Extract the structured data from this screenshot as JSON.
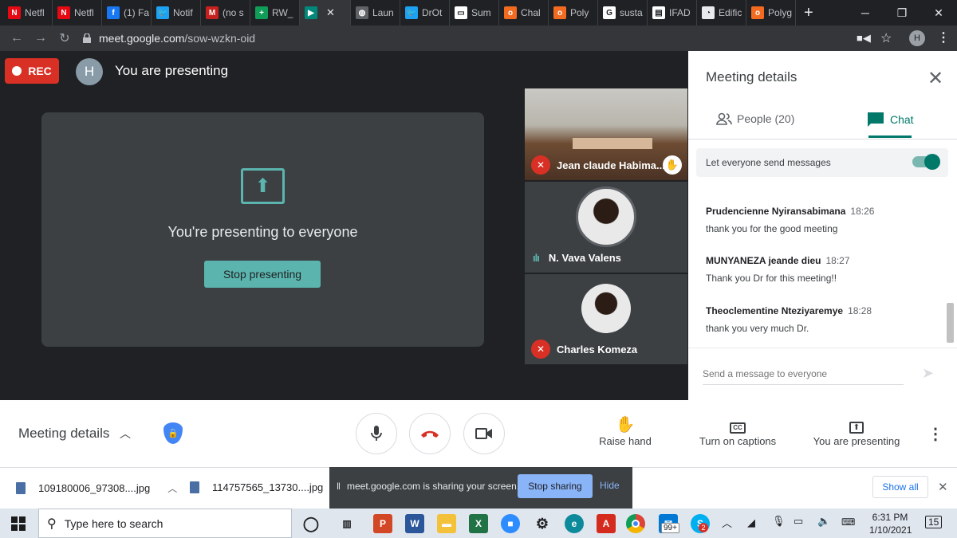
{
  "browser": {
    "tabs": [
      {
        "label": "Netfl",
        "icon": "netflix-icon",
        "color": "#e50914",
        "glyph": "N"
      },
      {
        "label": "Netfl",
        "icon": "netflix-icon",
        "color": "#e50914",
        "glyph": "N"
      },
      {
        "label": "(1) Fa",
        "icon": "facebook-icon",
        "color": "#1877f2",
        "glyph": "f"
      },
      {
        "label": "Notif",
        "icon": "twitter-icon",
        "color": "#1da1f2",
        "glyph": "🐦"
      },
      {
        "label": "(no s",
        "icon": "gmail-icon",
        "color": "#c5221f",
        "glyph": "M"
      },
      {
        "label": "RW_",
        "icon": "sheets-icon",
        "color": "#0f9d58",
        "glyph": "+"
      },
      {
        "label": "",
        "icon": "meet-icon",
        "color": "#00897b",
        "glyph": "▶",
        "active": true
      },
      {
        "label": "Laun",
        "icon": "globe-icon",
        "color": "#5f6368",
        "glyph": "◍"
      },
      {
        "label": "DrOt",
        "icon": "twitter-icon",
        "color": "#1da1f2",
        "glyph": "🐦"
      },
      {
        "label": "Sum",
        "icon": "page-icon",
        "color": "#ffffff",
        "glyph": "▭"
      },
      {
        "label": "Chal",
        "icon": "polyglot-icon",
        "color": "#f26b21",
        "glyph": "o"
      },
      {
        "label": "Poly",
        "icon": "polyglot-icon",
        "color": "#f26b21",
        "glyph": "o"
      },
      {
        "label": "susta",
        "icon": "google-icon",
        "color": "#ffffff",
        "glyph": "G"
      },
      {
        "label": "IFAD",
        "icon": "ifad-icon",
        "color": "#ffffff",
        "glyph": "▤"
      },
      {
        "label": "Edific",
        "icon": "edge-icon",
        "color": "#e8eaed",
        "glyph": "◔"
      },
      {
        "label": "Polyg",
        "icon": "polyglot-icon",
        "color": "#f26b21",
        "glyph": "o"
      }
    ],
    "url_host": "meet.google.com",
    "url_path": "/sow-wzkn-oid",
    "profile_initial": "H"
  },
  "meet": {
    "rec_label": "REC",
    "user_initial": "H",
    "presenting_title": "You are presenting",
    "presenting_message": "You're presenting to everyone",
    "stop_presenting_label": "Stop presenting",
    "participants": [
      {
        "name": "Jean claude Habima...",
        "muted": true
      },
      {
        "name": "N. Vava Valens",
        "muted": false
      },
      {
        "name": "Charles Komeza",
        "muted": true
      }
    ]
  },
  "panel": {
    "title": "Meeting details",
    "people_tab": "People (20)",
    "chat_tab": "Chat",
    "send_all_label": "Let everyone send messages",
    "messages": [
      {
        "sender": "Prudencienne Nyiransabimana",
        "time": "18:26",
        "text": "thank you for the good meeting"
      },
      {
        "sender": "MUNYANEZA jeande dieu",
        "time": "18:27",
        "text": "Thank you Dr for this meeting!!"
      },
      {
        "sender": "Theoclementine Nteziyaremye",
        "time": "18:28",
        "text": "thank you very much Dr."
      }
    ],
    "input_placeholder": "Send a message to everyone"
  },
  "controls": {
    "meeting_details": "Meeting details",
    "raise_hand": "Raise hand",
    "captions": "Turn on captions",
    "presenting": "You are presenting"
  },
  "downloads": {
    "files": [
      "109180006_97308....jpg",
      "114757565_13730....jpg"
    ],
    "share_text": "meet.google.com is sharing your screen.",
    "stop_sharing": "Stop sharing",
    "hide": "Hide",
    "show_all": "Show all"
  },
  "taskbar": {
    "search_placeholder": "Type here to search",
    "time": "6:31 PM",
    "date": "1/10/2021",
    "mail_badge": "99+",
    "skype_badge": "2",
    "notif_count": "15"
  }
}
